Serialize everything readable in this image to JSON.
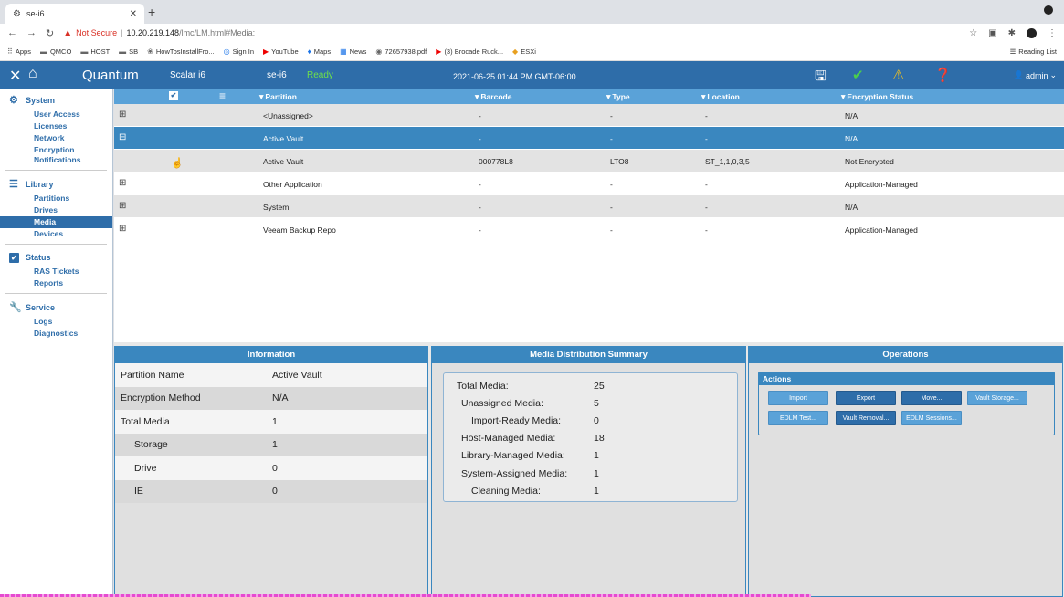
{
  "browser": {
    "tab_title": "se-i6",
    "tab_icon": "gear-icon",
    "new_tab": "+",
    "not_secure": "Not Secure",
    "url_host": "10.20.219.148",
    "url_path": "/lmc/LM.html#Media:",
    "bookmarks": [
      {
        "label": "Apps",
        "icon": "apps-grid-icon"
      },
      {
        "label": "QMCO",
        "icon": "folder-icon"
      },
      {
        "label": "HOST",
        "icon": "folder-icon"
      },
      {
        "label": "SB",
        "icon": "folder-icon"
      },
      {
        "label": "HowTosInstallFro...",
        "icon": "link-icon"
      },
      {
        "label": "Sign In",
        "icon": "sync-icon"
      },
      {
        "label": "YouTube",
        "icon": "youtube-icon"
      },
      {
        "label": "Maps",
        "icon": "maps-pin-icon"
      },
      {
        "label": "News",
        "icon": "news-icon"
      },
      {
        "label": "72657938.pdf",
        "icon": "globe-icon"
      },
      {
        "label": "(3) Brocade Ruck...",
        "icon": "youtube-icon"
      },
      {
        "label": "ESXi",
        "icon": "vm-icon"
      }
    ],
    "reading_list": "Reading List"
  },
  "header": {
    "brand": "Quantum",
    "product": "Scalar i6",
    "hostname": "se-i6",
    "state": "Ready",
    "datetime": "2021-06-25 01:44 PM GMT-06:00",
    "user": "admin"
  },
  "sidebar": {
    "sections": [
      {
        "title": "System",
        "icon": "gears-icon",
        "items": [
          "User Access",
          "Licenses",
          "Network",
          "Encryption Notifications"
        ]
      },
      {
        "title": "Library",
        "icon": "library-icon",
        "items": [
          "Partitions",
          "Drives",
          "Media",
          "Devices"
        ],
        "active": "Media"
      },
      {
        "title": "Status",
        "icon": "checkbox-icon",
        "items": [
          "RAS Tickets",
          "Reports"
        ]
      },
      {
        "title": "Service",
        "icon": "wrench-icon",
        "items": [
          "Logs",
          "Diagnostics"
        ]
      }
    ]
  },
  "grid": {
    "columns": [
      "Partition",
      "Barcode",
      "Type",
      "Location",
      "Encryption Status"
    ],
    "rows": [
      {
        "expander": "⊞",
        "partition": "<Unassigned>",
        "barcode": "-",
        "type": "-",
        "location": "-",
        "encryption": "N/A",
        "style": "grey"
      },
      {
        "expander": "⊟",
        "partition": "Active Vault",
        "barcode": "-",
        "type": "-",
        "location": "-",
        "encryption": "N/A",
        "style": "sel"
      },
      {
        "expander": "",
        "partition": "Active Vault",
        "barcode": "000778L8",
        "type": "LTO8",
        "location": "ST_1,1,0,3,5",
        "encryption": "Not Encrypted",
        "style": "grey"
      },
      {
        "expander": "⊞",
        "partition": "Other Application",
        "barcode": "-",
        "type": "-",
        "location": "-",
        "encryption": "Application-Managed",
        "style": "white"
      },
      {
        "expander": "⊞",
        "partition": "System",
        "barcode": "-",
        "type": "-",
        "location": "-",
        "encryption": "N/A",
        "style": "grey"
      },
      {
        "expander": "⊞",
        "partition": "Veeam Backup Repo",
        "barcode": "-",
        "type": "-",
        "location": "-",
        "encryption": "Application-Managed",
        "style": "white"
      }
    ]
  },
  "information": {
    "title": "Information",
    "rows": [
      {
        "key": "Partition Name",
        "value": "Active Vault"
      },
      {
        "key": "Encryption Method",
        "value": "N/A"
      },
      {
        "key": "Total Media",
        "value": "1"
      },
      {
        "key": "Storage",
        "value": "1"
      },
      {
        "key": "Drive",
        "value": "0"
      },
      {
        "key": "IE",
        "value": "0"
      }
    ]
  },
  "summary": {
    "title": "Media Distribution Summary",
    "rows": [
      {
        "key": "Total Media:",
        "value": "25"
      },
      {
        "key": "Unassigned Media:",
        "value": "5"
      },
      {
        "key": "Import-Ready Media:",
        "value": "0"
      },
      {
        "key": "Host-Managed Media:",
        "value": "18"
      },
      {
        "key": "Library-Managed Media:",
        "value": "1"
      },
      {
        "key": "System-Assigned Media:",
        "value": "1"
      },
      {
        "key": "Cleaning Media:",
        "value": "1"
      }
    ]
  },
  "operations": {
    "title": "Operations",
    "actions_title": "Actions",
    "buttons": [
      "Import",
      "Export",
      "Move...",
      "Vault Storage...",
      "EDLM Test...",
      "Vault Removal...",
      "EDLM Sessions..."
    ]
  },
  "colors": {
    "header_blue": "#2e6da9",
    "grid_head_blue": "#5aa2d8",
    "selected_row": "#3a87bf",
    "ready_green": "#6fe04a"
  }
}
